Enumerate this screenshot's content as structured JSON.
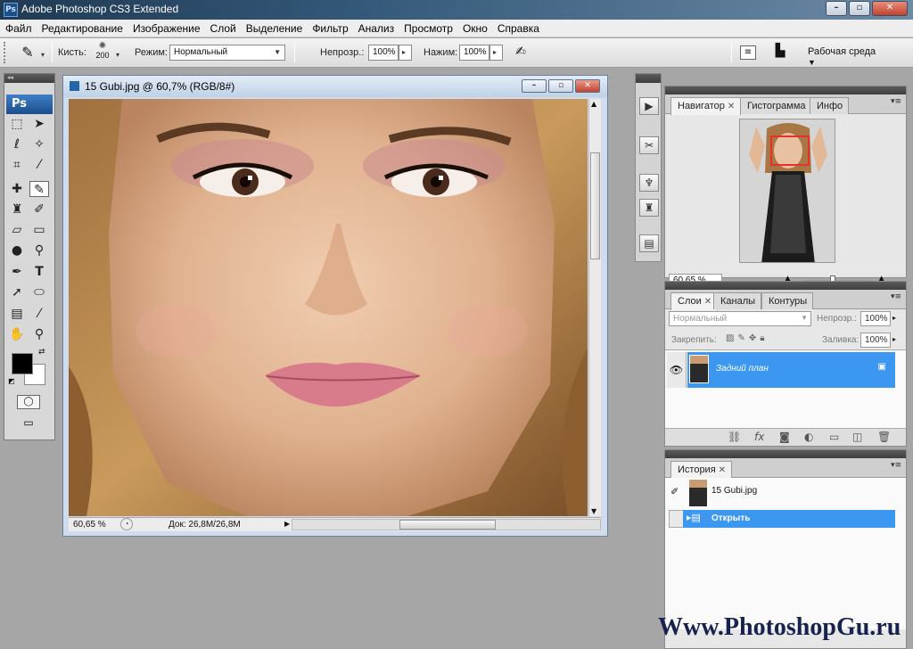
{
  "app": {
    "title": "Adobe Photoshop CS3 Extended",
    "logo": "Ps"
  },
  "window_controls": {
    "minimize": "–",
    "maximize": "▫",
    "close": "✕"
  },
  "menu": [
    "Файл",
    "Редактирование",
    "Изображение",
    "Слой",
    "Выделение",
    "Фильтр",
    "Анализ",
    "Просмотр",
    "Окно",
    "Справка"
  ],
  "options": {
    "brush_label": "Кисть:",
    "brush_size": "200",
    "mode_label": "Режим:",
    "mode_value": "Нормальный",
    "opacity_label": "Непрозр.:",
    "opacity_value": "100%",
    "flow_label": "Нажим:",
    "flow_value": "100%",
    "workspace": "Рабочая среда"
  },
  "toolbox": {
    "tools": [
      "rect-marquee-icon",
      "move-icon",
      "lasso-icon",
      "magic-wand-icon",
      "crop-icon",
      "eyedropper-icon",
      "healing-brush-icon",
      "brush-icon",
      "clone-stamp-icon",
      "history-brush-icon",
      "eraser-icon",
      "gradient-icon",
      "blur-icon",
      "dodge-icon",
      "pen-icon",
      "type-icon",
      "path-selection-icon",
      "ellipse-icon",
      "notes-icon",
      "eyedropper2-icon",
      "hand-icon",
      "zoom-icon"
    ],
    "colors": {
      "foreground": "#000000",
      "background": "#ffffff"
    }
  },
  "document": {
    "title": "15 Gubi.jpg @ 60,7% (RGB/8#)",
    "zoom": "60,65 %",
    "info": "Док: 26,8M/26,8M"
  },
  "navigator": {
    "tabs": [
      "Навигатор",
      "Гистограмма",
      "Инфо"
    ],
    "zoom": "60.65 %"
  },
  "layers": {
    "tabs": [
      "Слои",
      "Каналы",
      "Контуры"
    ],
    "blend_mode": "Нормальный",
    "opacity_label": "Непрозр.:",
    "opacity_value": "100%",
    "lock_label": "Закрепить:",
    "fill_label": "Заливка:",
    "fill_value": "100%",
    "layer_name": "Задний план"
  },
  "history": {
    "tabs": [
      "История"
    ],
    "snapshot": "15 Gubi.jpg",
    "step": "Открыть"
  },
  "watermark": "Www.PhotoshopGu.ru",
  "colors": {
    "selection": "#3b97f0",
    "panel_header": "#4a4a4a",
    "title_gradient": "#35597a"
  }
}
